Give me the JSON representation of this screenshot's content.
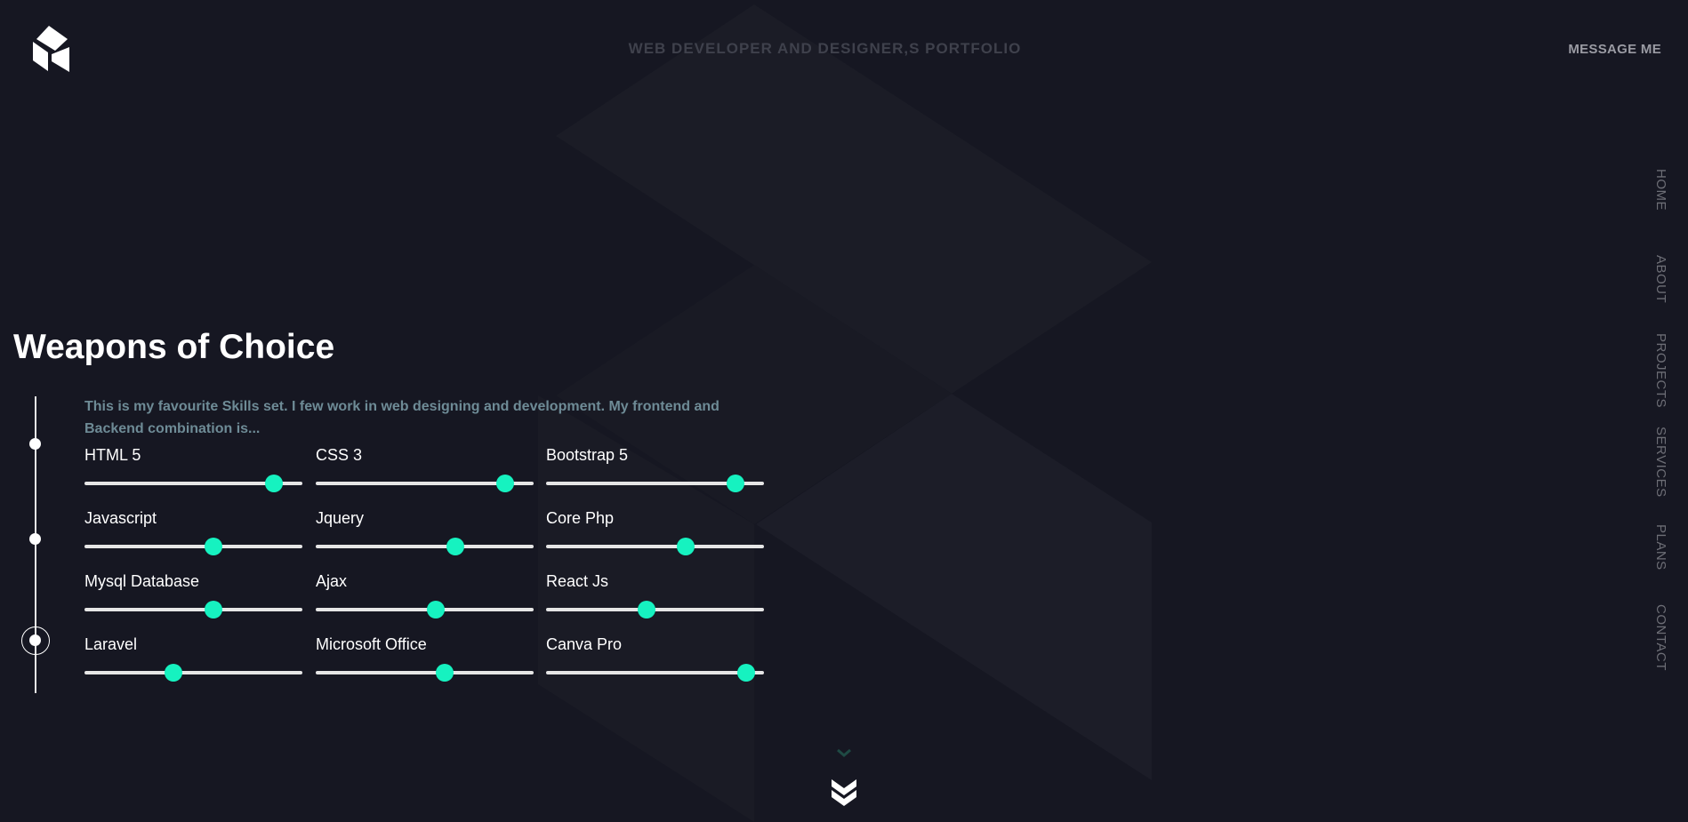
{
  "header": {
    "logo_icon": "brand-logo-icon",
    "site_title": "WEB DEVELOPER AND DESIGNER,S PORTFOLIO",
    "message_button": "MESSAGE ME"
  },
  "nav": {
    "items": [
      {
        "label": "HOME"
      },
      {
        "label": "ABOUT"
      },
      {
        "label": "PROJECTS"
      },
      {
        "label": "SERVICES"
      },
      {
        "label": "PLANS"
      },
      {
        "label": "CONTACT"
      }
    ]
  },
  "skills_section": {
    "title": "Weapons of Choice",
    "intro": "This is my favourite Skills set. I few work in web designing and development. My frontend and Backend combination is...",
    "skills": [
      {
        "name": "HTML 5",
        "level": 87
      },
      {
        "name": "CSS 3",
        "level": 87
      },
      {
        "name": "Bootstrap 5",
        "level": 87
      },
      {
        "name": "Javascript",
        "level": 59
      },
      {
        "name": "Jquery",
        "level": 64
      },
      {
        "name": "Core Php",
        "level": 64
      },
      {
        "name": "Mysql Database",
        "level": 59
      },
      {
        "name": "Ajax",
        "level": 55
      },
      {
        "name": "React Js",
        "level": 46
      },
      {
        "name": "Laravel",
        "level": 41
      },
      {
        "name": "Microsoft Office",
        "level": 59
      },
      {
        "name": "Canva Pro",
        "level": 92
      }
    ]
  },
  "colors": {
    "background": "#161722",
    "accent": "#16f2c0",
    "intro_text": "#6e8b96"
  },
  "icons": {
    "scroll_hint": "chevron-down-icon",
    "scroll_button": "double-chevron-down-icon"
  }
}
